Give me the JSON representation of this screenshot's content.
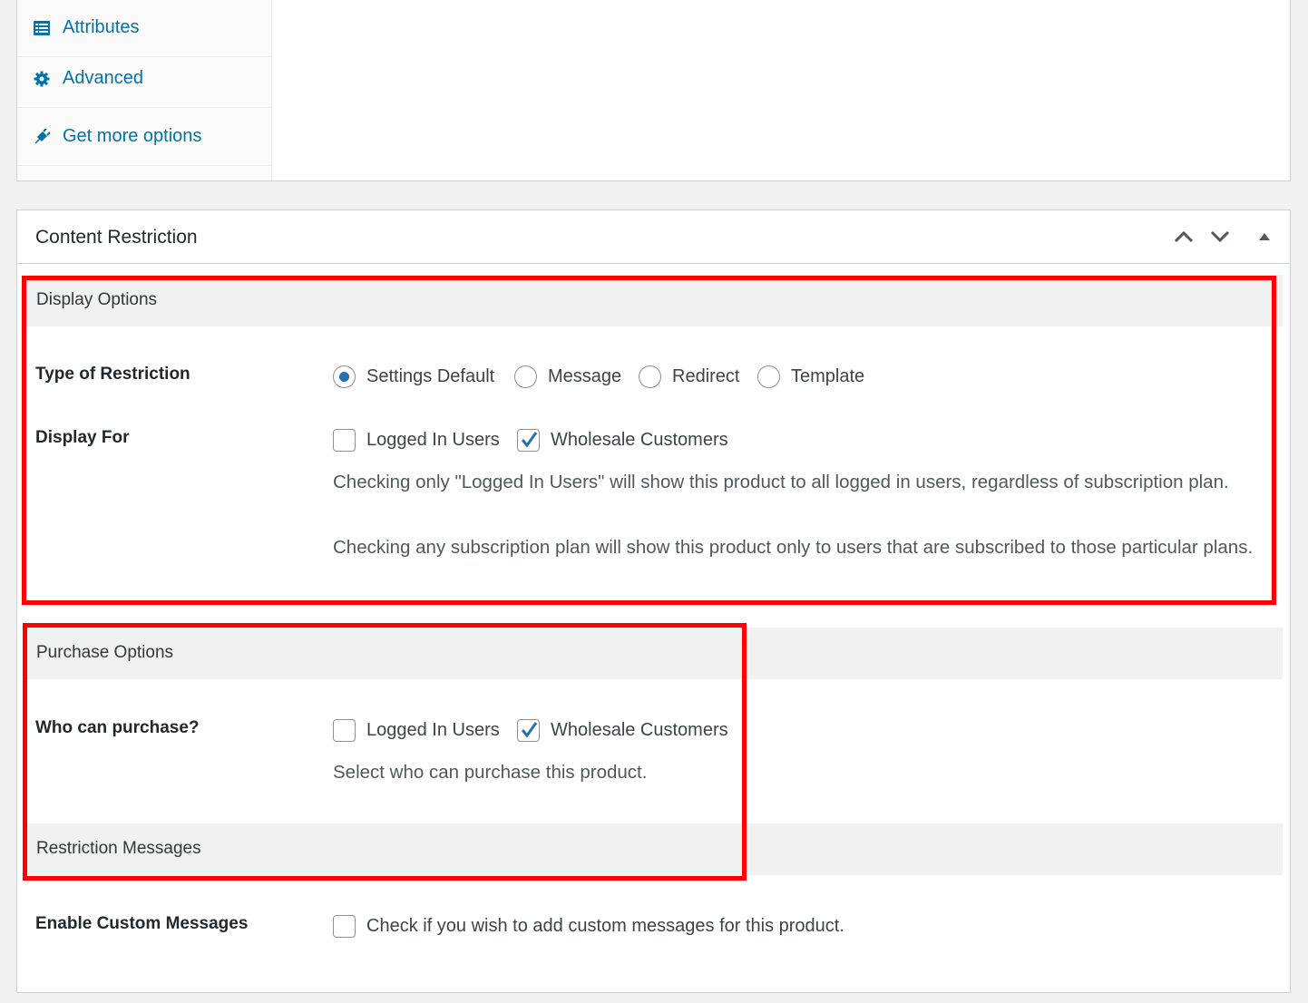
{
  "product_data_tabs": [
    {
      "label": "Attributes",
      "icon": "list-icon"
    },
    {
      "label": "Advanced",
      "icon": "gear-icon"
    },
    {
      "label": "Get more options",
      "icon": "plug-icon"
    }
  ],
  "metabox": {
    "title": "Content Restriction",
    "controls": [
      "move-up-icon",
      "move-down-icon",
      "toggle-icon"
    ]
  },
  "display_options": {
    "heading": "Display Options",
    "type_of_restriction": {
      "label": "Type of Restriction",
      "options": [
        "Settings Default",
        "Message",
        "Redirect",
        "Template"
      ],
      "selected": "Settings Default"
    },
    "display_for": {
      "label": "Display For",
      "options": [
        {
          "label": "Logged In Users",
          "checked": false
        },
        {
          "label": "Wholesale Customers",
          "checked": true
        }
      ],
      "desc1": "Checking only \"Logged In Users\" will show this product to all logged in users, regardless of subscription plan.",
      "desc2": "Checking any subscription plan will show this product only to users that are subscribed to those particular plans."
    }
  },
  "purchase_options": {
    "heading": "Purchase Options",
    "who_can_purchase": {
      "label": "Who can purchase?",
      "options": [
        {
          "label": "Logged In Users",
          "checked": false
        },
        {
          "label": "Wholesale Customers",
          "checked": true
        }
      ],
      "desc": "Select who can purchase this product."
    }
  },
  "restriction_messages": {
    "heading": "Restriction Messages",
    "enable_custom": {
      "label": "Enable Custom Messages",
      "checkbox_label": "Check if you wish to add custom messages for this product.",
      "checked": false
    }
  },
  "colors": {
    "link": "#0073aa",
    "highlight": "#ff0000",
    "radio_checked": "#2271b1"
  }
}
